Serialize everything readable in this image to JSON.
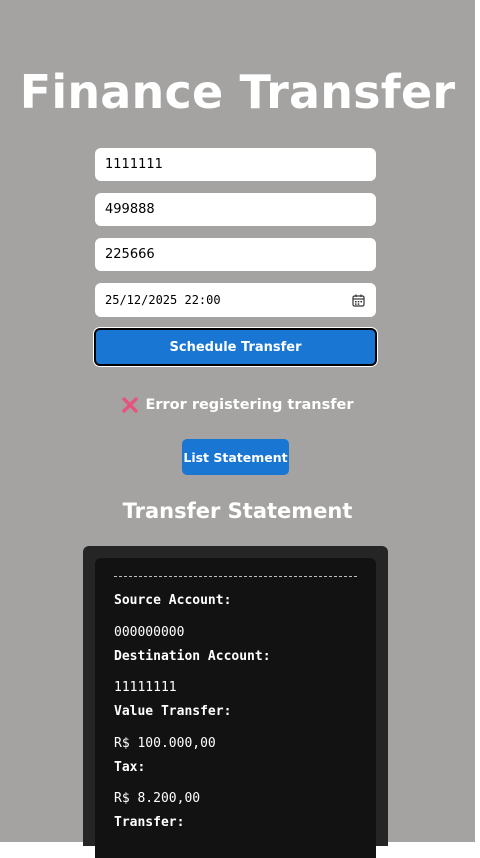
{
  "app": {
    "title": "Finance Transfer"
  },
  "form": {
    "source_account": "1111111",
    "destination_account": "499888",
    "value": "225666",
    "datetime": "25/12/2025 22:00",
    "schedule_button": "Schedule Transfer"
  },
  "status": {
    "error_message": "Error registering transfer",
    "error_color": "#e5547d"
  },
  "actions": {
    "list_statement_button": "List Statement"
  },
  "statement": {
    "title": "Transfer Statement",
    "entry": {
      "source_label": "Source Account:",
      "source_value": "000000000",
      "destination_label": "Destination Account:",
      "destination_value": "11111111",
      "value_label": "Value Transfer:",
      "value_value": "R$ 100.000,00",
      "tax_label": "Tax:",
      "tax_value": "R$ 8.200,00",
      "transfer_label": "Transfer:"
    }
  },
  "theme": {
    "background": "#a4a3a1",
    "accent": "#1976d2",
    "panel": "#252525",
    "panel_inner": "#121212"
  },
  "icons": {
    "calendar": "calendar-icon",
    "error": "error-x-icon"
  }
}
